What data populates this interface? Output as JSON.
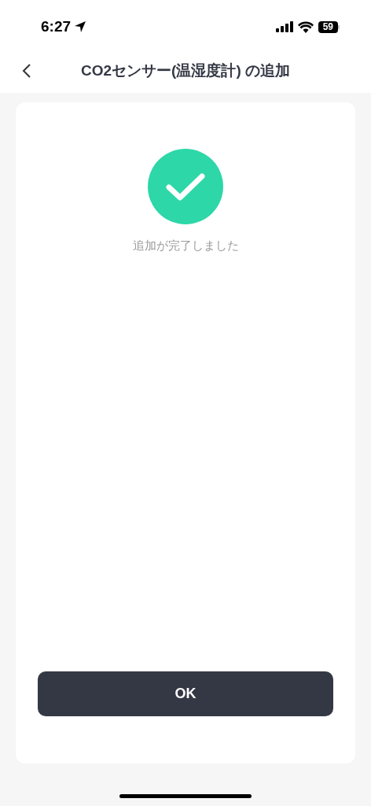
{
  "status_bar": {
    "time": "6:27",
    "battery": "59"
  },
  "nav": {
    "title": "CO2センサー(温湿度計) の追加"
  },
  "result": {
    "message": "追加が完了しました"
  },
  "button": {
    "label": "OK"
  }
}
